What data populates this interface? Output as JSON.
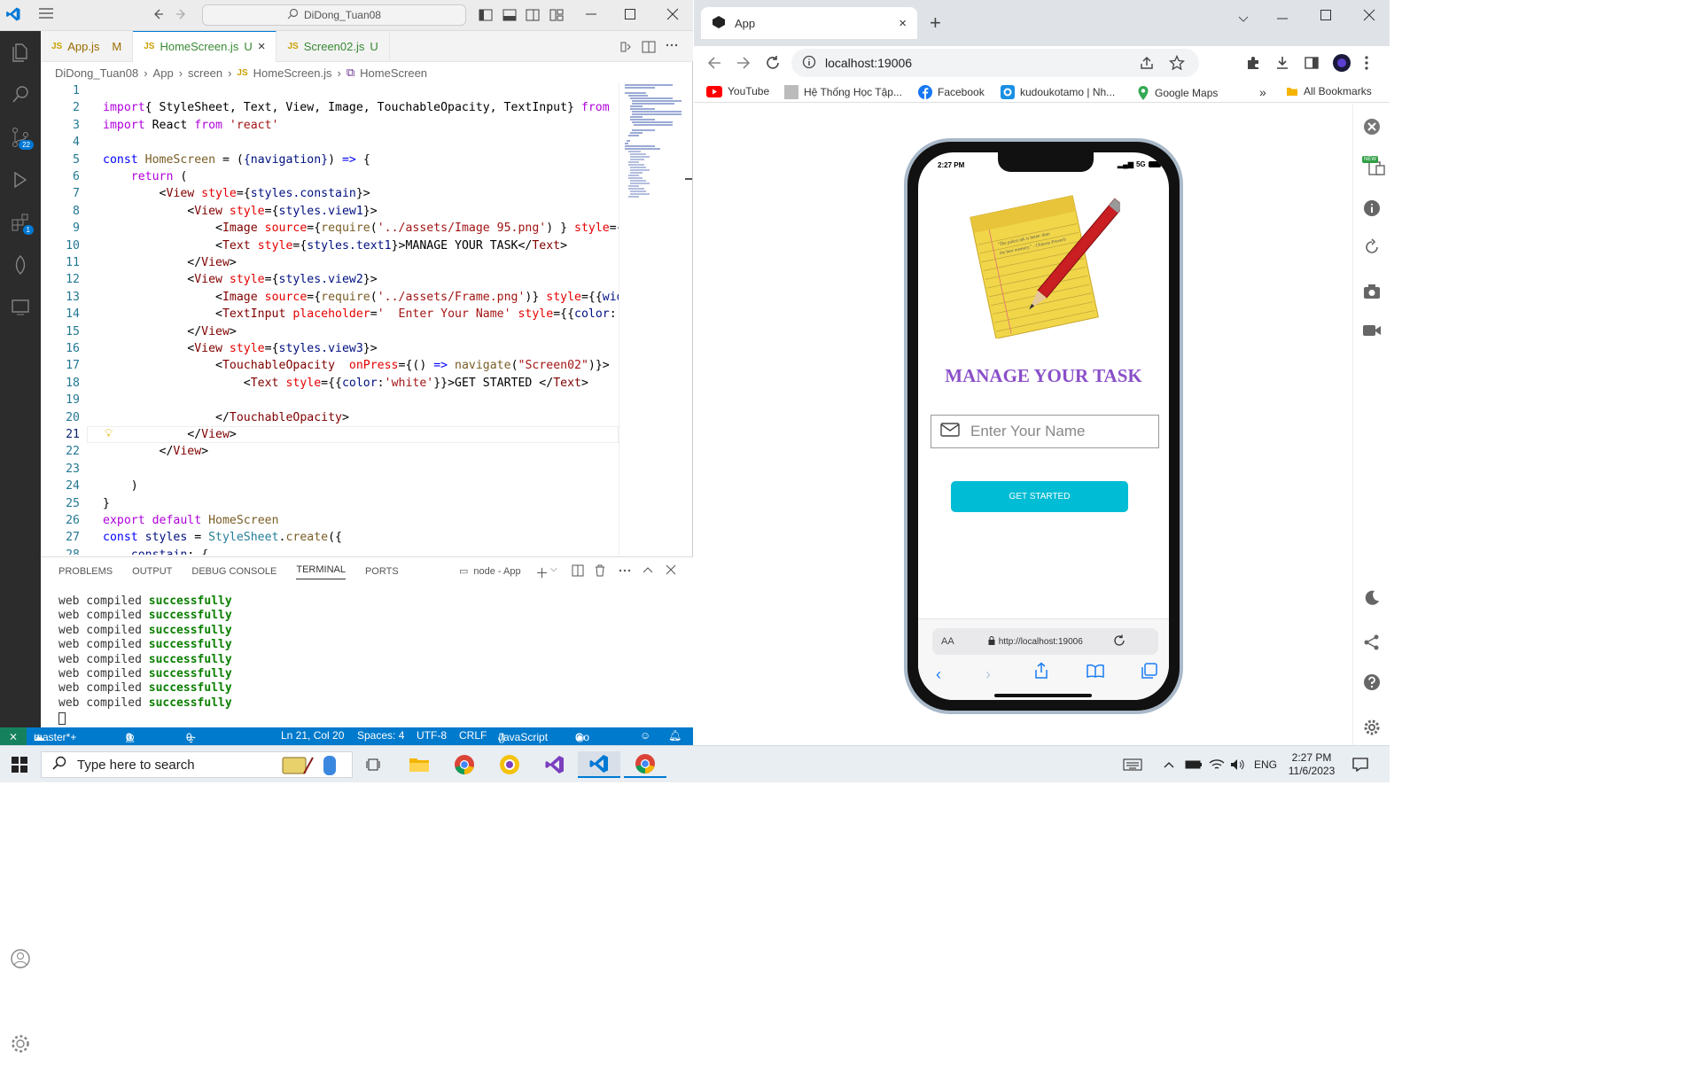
{
  "vscode": {
    "search": "DiDong_Tuan08",
    "tabs": [
      {
        "label": "App.js",
        "badge": "M"
      },
      {
        "label": "HomeScreen.js",
        "badge": "U",
        "close": "×"
      },
      {
        "label": "Screen02.js",
        "badge": "U"
      }
    ],
    "js_tag": "JS",
    "breadcrumb": [
      "DiDong_Tuan08",
      "App",
      "screen",
      "HomeScreen.js",
      "HomeScreen"
    ],
    "activity_badges": {
      "scm": "22",
      "ext": "1"
    },
    "panel_tabs": [
      "PROBLEMS",
      "OUTPUT",
      "DEBUG CONSOLE",
      "TERMINAL",
      "PORTS"
    ],
    "terminal_name": "node - App",
    "terminal_prefix": "web compiled",
    "terminal_success": "successfully",
    "status": {
      "branch": "master*+",
      "errors": "0",
      "warnings": "0",
      "ports": "0",
      "position": "Ln 21, Col 20",
      "spaces": "Spaces: 4",
      "encoding": "UTF-8",
      "eol": "CRLF",
      "language": "JavaScript",
      "golive": "Go Live"
    }
  },
  "chrome": {
    "tab_title": "App",
    "url": "localhost:19006",
    "bookmarks": [
      "YouTube",
      "Hệ Thống Học Tập...",
      "Facebook",
      "kudoukotamo | Nh...",
      "Google Maps"
    ],
    "more": "»",
    "all_bookmarks": "All Bookmarks",
    "new_badge": "NEW"
  },
  "app": {
    "time": "2:27 PM",
    "network": "5G",
    "title": "MANAGE YOUR TASK",
    "input_placeholder": "Enter Your Name",
    "button": "GET STARTED",
    "safari_aa": "AA",
    "safari_url": "http://localhost:19006",
    "note_quote": "\"The palest ink is better than the best memory.\" - Chinese Proverb"
  },
  "taskbar": {
    "search_placeholder": "Type here to search",
    "lang": "ENG",
    "time": "2:27 PM",
    "date": "11/6/2023"
  },
  "icons": [
    "vscode-logo-icon",
    "menu-icon",
    "back-arrow-icon",
    "forward-arrow-icon",
    "search-icon",
    "explorer-icon",
    "source-control-icon",
    "run-debug-icon",
    "extensions-icon",
    "expo-icon",
    "remote-explorer-icon",
    "account-icon",
    "gear-icon",
    "split-icon",
    "more-icon",
    "chrome-back-icon",
    "chrome-forward-icon",
    "reload-icon",
    "info-icon",
    "share-icon",
    "star-icon",
    "puzzle-icon",
    "download-icon",
    "sidepanel-icon",
    "profile-icon",
    "kebab-icon",
    "close-circle-icon",
    "device-icon",
    "rotate-icon",
    "camera-icon",
    "video-icon",
    "moon-icon",
    "question-icon",
    "settings-icon",
    "windows-start-icon",
    "mail-icon",
    "lock-icon",
    "refresh-icon"
  ]
}
